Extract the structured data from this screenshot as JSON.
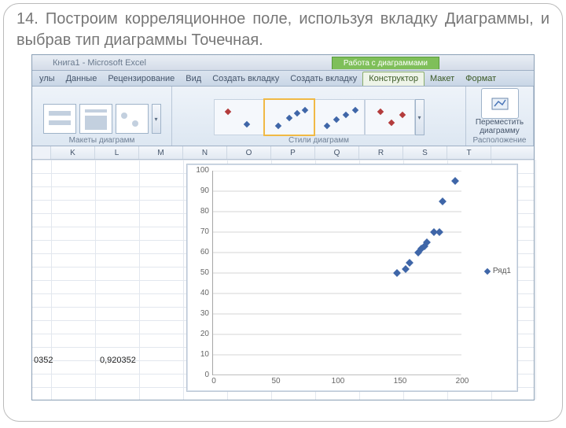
{
  "slide": {
    "text": "14. Построим корреляционное поле, используя вкладку Диаграммы, и выбрав тип диаграммы Точечная."
  },
  "titlebar": {
    "title": "Книга1 - Microsoft Excel",
    "chart_tools": "Работа с диаграммами"
  },
  "ribbon_tabs": {
    "t0": "улы",
    "t1": "Данные",
    "t2": "Рецензирование",
    "t3": "Вид",
    "t4": "Создать вкладку",
    "t5": "Создать вкладку",
    "t6": "Конструктор",
    "t7": "Макет",
    "t8": "Формат"
  },
  "ribbon_groups": {
    "layouts": "Макеты диаграмм",
    "styles": "Стили диаграмм",
    "location": "Расположение",
    "move_btn_l1": "Переместить",
    "move_btn_l2": "диаграмму"
  },
  "columns": [
    "K",
    "L",
    "M",
    "N",
    "O",
    "P",
    "Q",
    "R",
    "S",
    "T"
  ],
  "cells": {
    "a": "0352",
    "b": "0,920352"
  },
  "legend": {
    "series1": "Ряд1"
  },
  "y_ticks": [
    "0",
    "10",
    "20",
    "30",
    "40",
    "50",
    "60",
    "70",
    "80",
    "90",
    "100"
  ],
  "x_ticks": [
    "0",
    "50",
    "100",
    "150",
    "200"
  ],
  "chart_data": {
    "type": "scatter",
    "title": "",
    "xlabel": "",
    "ylabel": "",
    "xlim": [
      0,
      200
    ],
    "ylim": [
      0,
      100
    ],
    "series": [
      {
        "name": "Ряд1",
        "points": [
          {
            "x": 148,
            "y": 50
          },
          {
            "x": 155,
            "y": 52
          },
          {
            "x": 158,
            "y": 55
          },
          {
            "x": 165,
            "y": 60
          },
          {
            "x": 168,
            "y": 62
          },
          {
            "x": 170,
            "y": 63
          },
          {
            "x": 172,
            "y": 65
          },
          {
            "x": 178,
            "y": 70
          },
          {
            "x": 182,
            "y": 70
          },
          {
            "x": 185,
            "y": 85
          },
          {
            "x": 195,
            "y": 95
          }
        ]
      }
    ]
  }
}
